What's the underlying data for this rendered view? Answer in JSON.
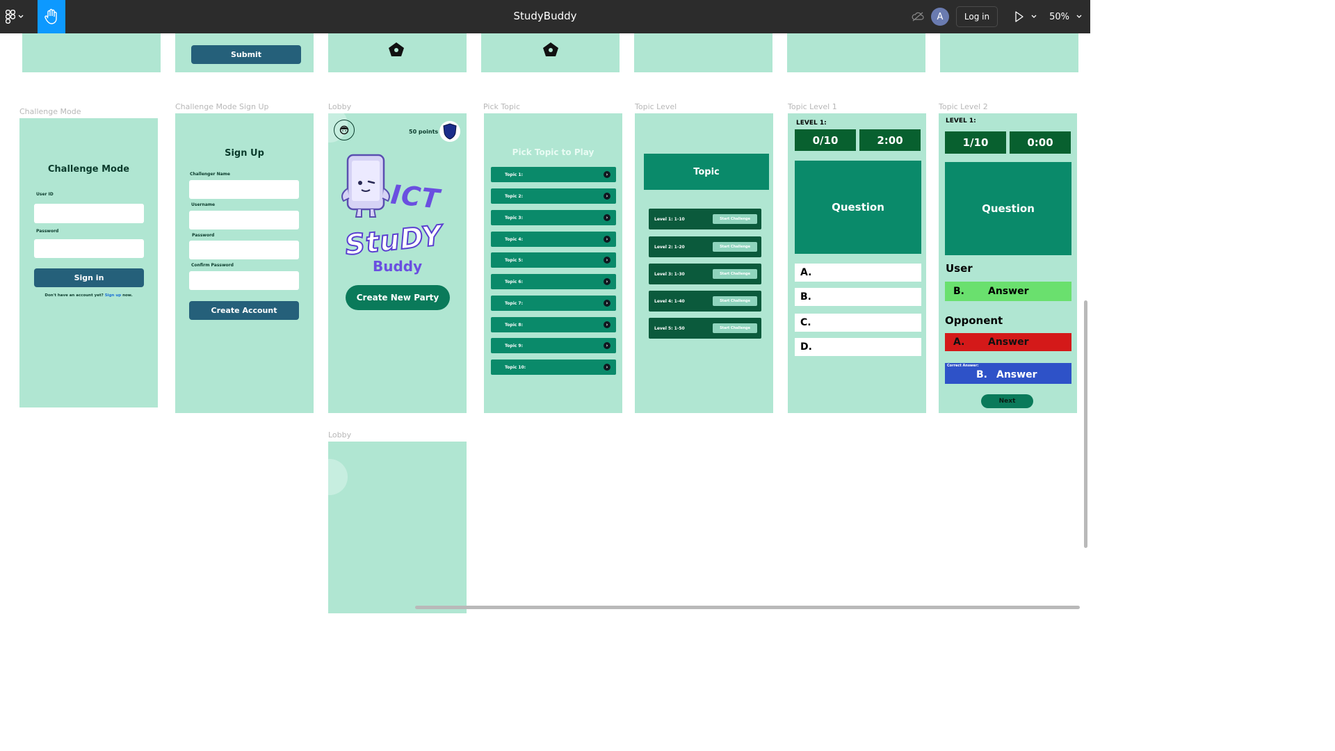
{
  "app": {
    "title": "StudyBuddy",
    "avatar_letter": "A",
    "login_label": "Log in",
    "zoom": "50%"
  },
  "top_frames": {
    "submit_label": "Submit"
  },
  "frames": {
    "challenge_mode": {
      "label": "Challenge Mode",
      "heading": "Challenge Mode",
      "user_id_label": "User ID",
      "password_label": "Password",
      "signin_label": "Sign in",
      "footer_prefix": "Don't have an account yet?",
      "footer_link": "Sign up",
      "footer_suffix": "now."
    },
    "sign_up": {
      "label": "Challenge Mode Sign Up",
      "heading": "Sign Up",
      "challenger_name_label": "Challenger Name",
      "username_label": "Username",
      "password_label": "Password",
      "confirm_password_label": "Confirm Password",
      "create_label": "Create Account"
    },
    "lobby": {
      "label": "Lobby",
      "points": "50 points",
      "logo_ict": "ICT",
      "logo_study": "StuDY",
      "logo_buddy": "Buddy",
      "create_party_label": "Create New Party"
    },
    "pick_topic": {
      "label": "Pick Topic",
      "heading": "Pick Topic to Play",
      "topics": [
        "Topic 1:",
        "Topic 2:",
        "Topic 3:",
        "Topic 4:",
        "Topic 5:",
        "Topic 6:",
        "Topic 7:",
        "Topic 8:",
        "Topic 9:",
        "Topic 10:"
      ]
    },
    "topic_level": {
      "label": "Topic Level",
      "topic_title": "Topic",
      "levels": [
        "Level 1: 1-10",
        "Level 2: 1-20",
        "Level 3: 1-30",
        "Level 4: 1-40",
        "Level 5: 1-50"
      ],
      "start_label": "Start Challenge"
    },
    "topic_level_1": {
      "label": "Topic Level 1",
      "level_label": "LEVEL 1:",
      "score": "0/10",
      "timer": "2:00",
      "question": "Question",
      "options": [
        "A.",
        "B.",
        "C.",
        "D."
      ]
    },
    "topic_level_2": {
      "label": "Topic Level 2",
      "level_label": "LEVEL 1:",
      "score": "1/10",
      "timer": "0:00",
      "question": "Question",
      "user_label": "User",
      "user_letter": "B.",
      "user_answer": "Answer",
      "opponent_label": "Opponent",
      "opponent_letter": "A.",
      "opponent_answer": "Answer",
      "correct_label": "Correct Answer:",
      "correct_letter": "B.",
      "correct_answer": "Answer",
      "next_label": "Next"
    },
    "lobby_2": {
      "label": "Lobby"
    }
  },
  "colors": {
    "frame_bg": "#b0e6d2",
    "toolbar_bg": "#2c2c2c",
    "accent_blue": "#0d99ff",
    "navy_button": "#25607a",
    "teal": "#0a8a6a",
    "dark_green": "#08602f",
    "correct_green": "#6ae06e",
    "wrong_red": "#d41919",
    "answer_blue": "#2e52c8"
  }
}
